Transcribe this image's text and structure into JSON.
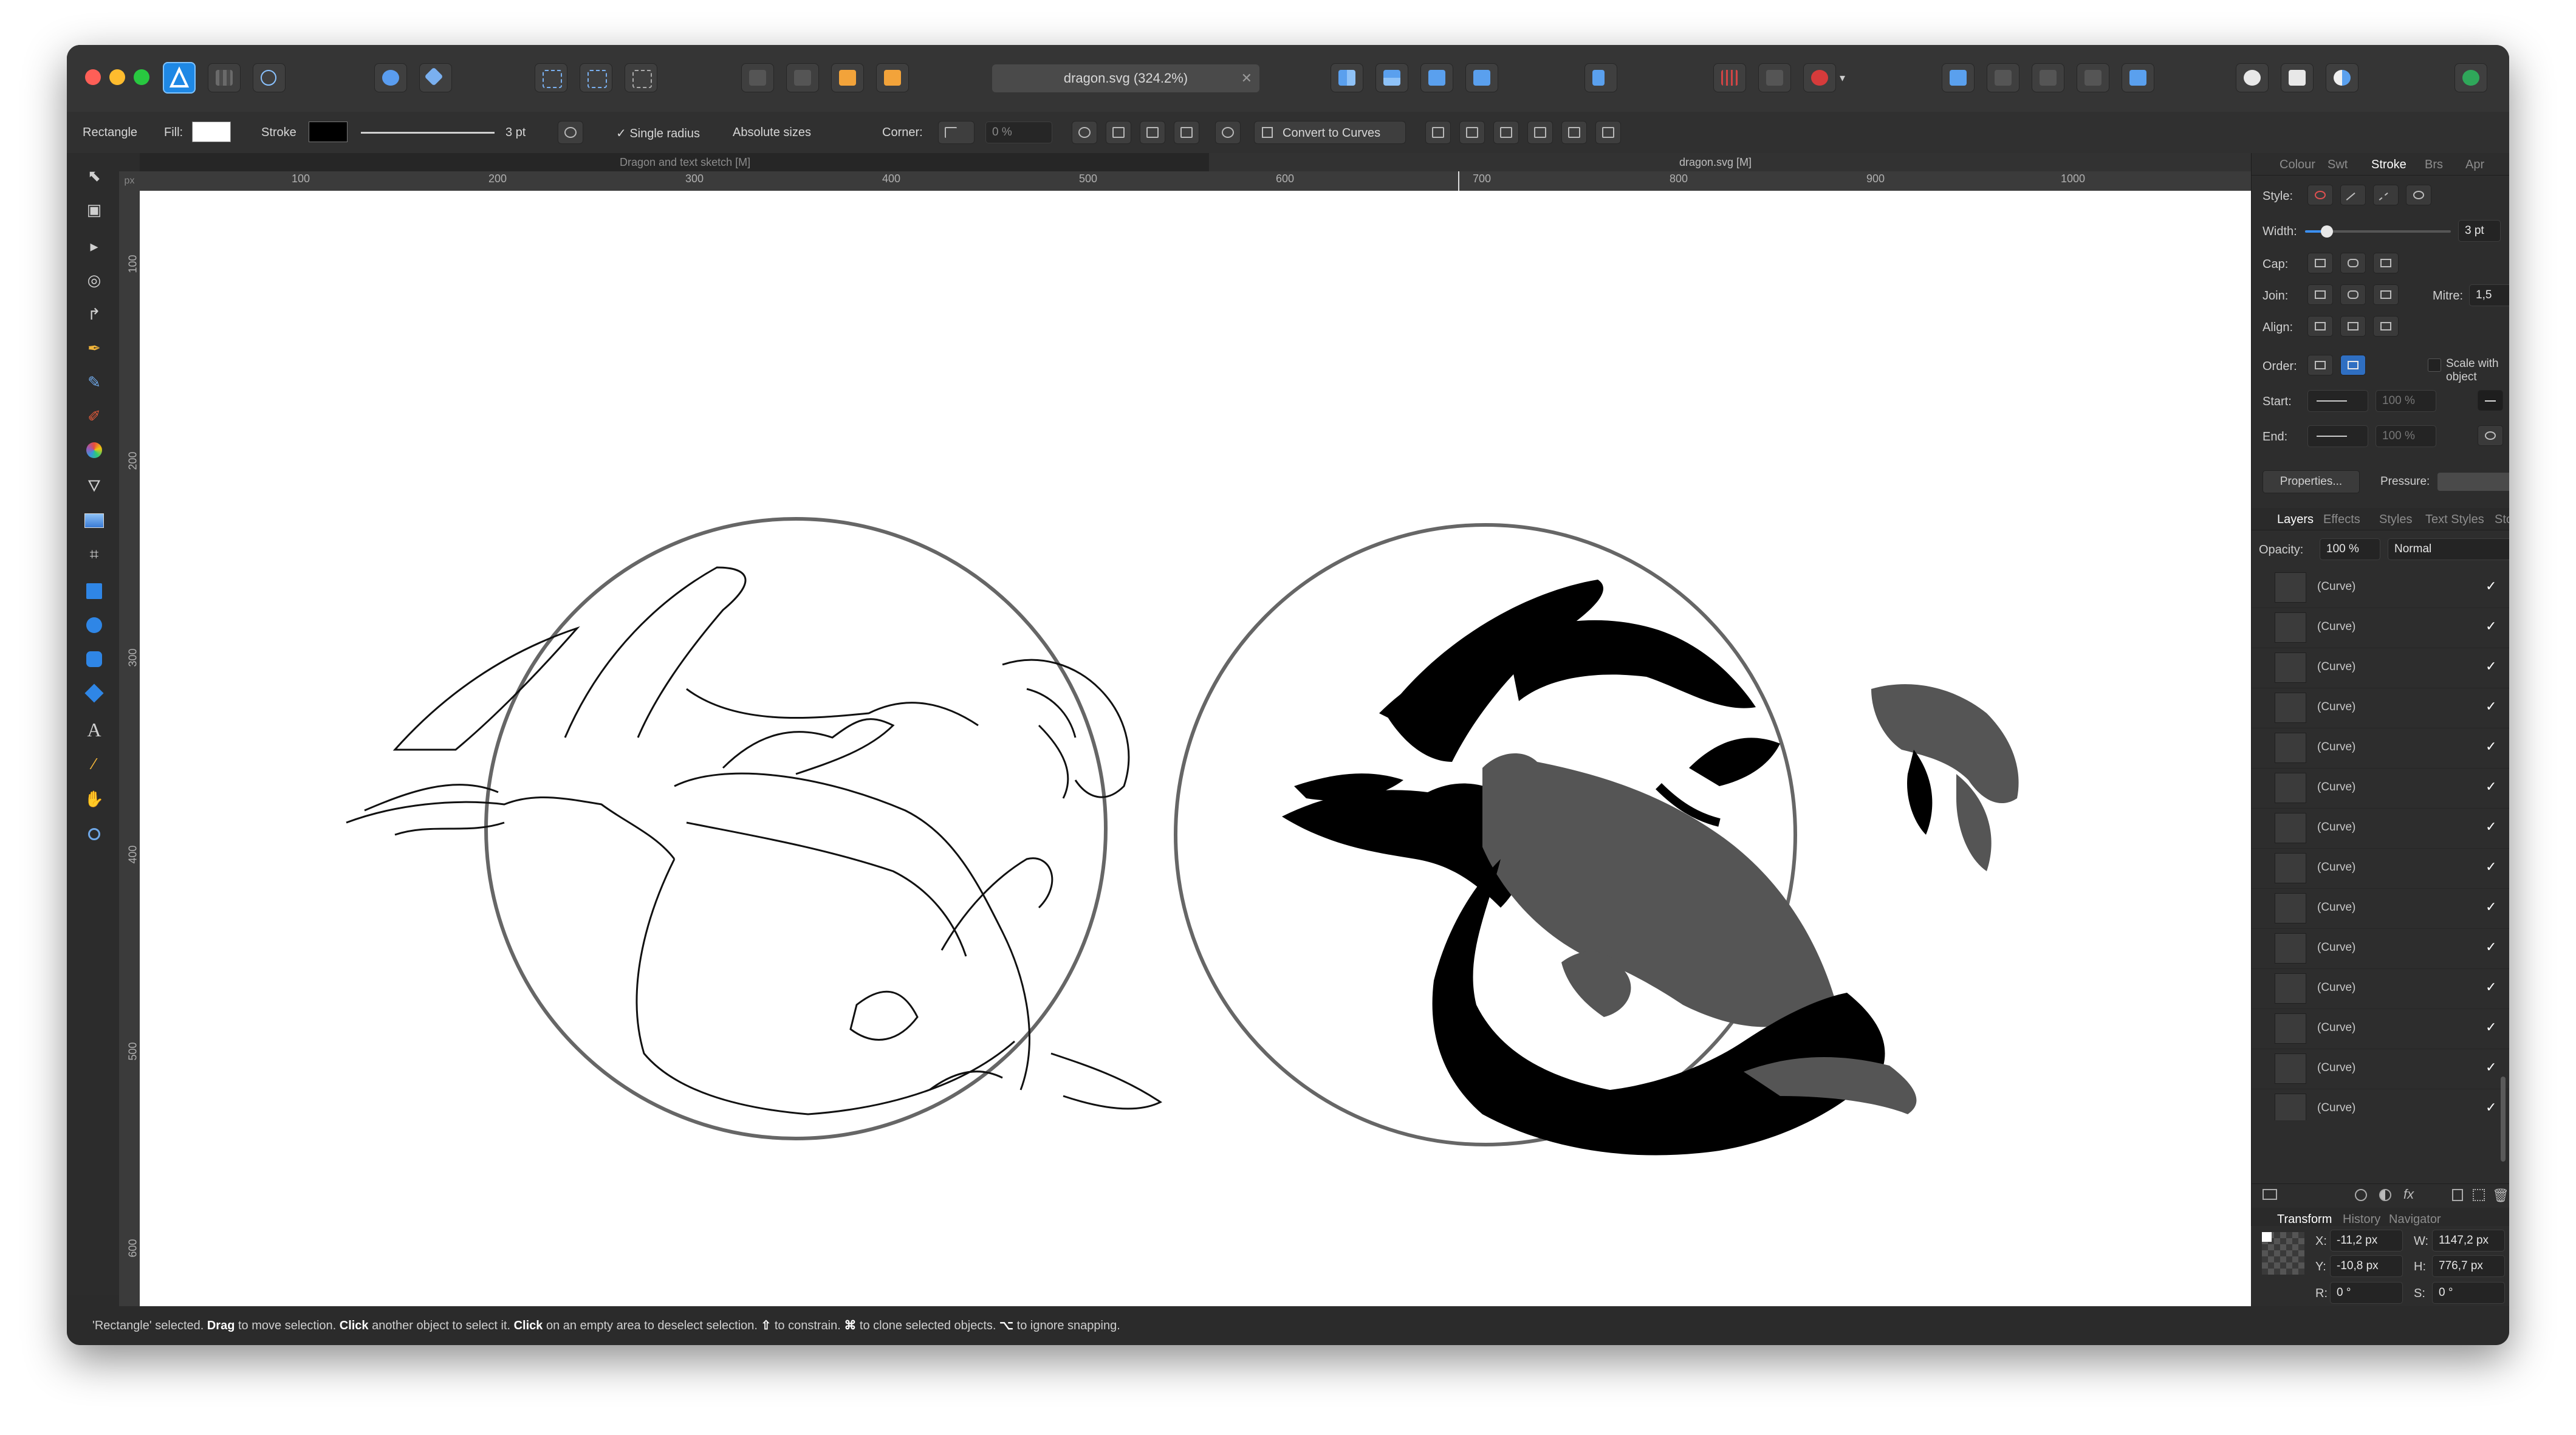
{
  "document": {
    "tab_title": "dragon.svg (324.2%)",
    "tab_close": "✕"
  },
  "context_toolbar": {
    "tool_name": "Rectangle",
    "fill_label": "Fill:",
    "stroke_label": "Stroke",
    "stroke_width": "3 pt",
    "single_radius": "✓ Single radius",
    "absolute_sizes": "Absolute sizes",
    "corner_label": "Corner:",
    "corner_value": "0 %",
    "convert_label": "Convert to Curves",
    "colors": {
      "fill": "#ffffff",
      "stroke": "#000000"
    }
  },
  "subtabs": [
    "Dragon and text sketch [M]",
    "dragon.svg [M]"
  ],
  "rulers": {
    "unit": "px",
    "h_ticks": [
      "100",
      "200",
      "300",
      "400",
      "500",
      "600",
      "700",
      "800",
      "900",
      "1000"
    ],
    "v_ticks": [
      "100",
      "200",
      "300",
      "400",
      "500",
      "600"
    ]
  },
  "tools": [
    "move-icon",
    "artboard-icon",
    "node-icon",
    "point-transform-icon",
    "corner-icon",
    "pen-icon",
    "pencil-icon",
    "vector-brush-icon",
    "fill-icon",
    "transparency-icon",
    "place-image-icon",
    "crop-icon",
    "rectangle-icon",
    "ellipse-icon",
    "rounded-rectangle-icon",
    "shape-icon",
    "artistic-text-icon",
    "color-picker-icon",
    "hand-icon",
    "zoom-icon"
  ],
  "stroke_panel": {
    "tabs": [
      "Colour",
      "Swt",
      "Stroke",
      "Brs",
      "Apr"
    ],
    "active": "Stroke",
    "style_label": "Style:",
    "width_label": "Width:",
    "width_value": "3 pt",
    "width_level": 0.15,
    "cap_label": "Cap:",
    "join_label": "Join:",
    "mitre_label": "Mitre:",
    "mitre_value": "1,5",
    "align_label": "Align:",
    "order_label": "Order:",
    "scale_label": "Scale with object",
    "start_label": "Start:",
    "end_label": "End:",
    "start_pct": "100 %",
    "end_pct": "100 %",
    "properties_btn": "Properties...",
    "pressure_label": "Pressure:"
  },
  "layers_panel": {
    "tabs": [
      "Layers",
      "Effects",
      "Styles",
      "Text Styles",
      "Stock"
    ],
    "active": "Layers",
    "opacity_label": "Opacity:",
    "opacity_value": "100 %",
    "blend_mode": "Normal",
    "items": [
      {
        "name": "(Curve)",
        "visible": "✓"
      },
      {
        "name": "(Curve)",
        "visible": "✓"
      },
      {
        "name": "(Curve)",
        "visible": "✓"
      },
      {
        "name": "(Curve)",
        "visible": "✓"
      },
      {
        "name": "(Curve)",
        "visible": "✓"
      },
      {
        "name": "(Curve)",
        "visible": "✓"
      },
      {
        "name": "(Curve)",
        "visible": "✓"
      },
      {
        "name": "(Curve)",
        "visible": "✓"
      },
      {
        "name": "(Curve)",
        "visible": "✓"
      },
      {
        "name": "(Curve)",
        "visible": "✓"
      },
      {
        "name": "(Curve)",
        "visible": "✓"
      },
      {
        "name": "(Curve)",
        "visible": "✓"
      },
      {
        "name": "(Curve)",
        "visible": "✓"
      },
      {
        "name": "(Curve)",
        "visible": "✓"
      }
    ]
  },
  "transform_panel": {
    "tabs": [
      "Transform",
      "History",
      "Navigator"
    ],
    "active": "Transform",
    "x_label": "X:",
    "x": "-11,2 px",
    "y_label": "Y:",
    "y": "-10,8 px",
    "w_label": "W:",
    "w": "1147,2 px",
    "h_label": "H:",
    "h": "776,7 px",
    "r_label": "R:",
    "r": "0 °",
    "s_label": "S:",
    "s": "0 °"
  },
  "status": {
    "p1": "'Rectangle' selected. ",
    "b1": "Drag",
    "p2": " to move selection. ",
    "b2": "Click",
    "p3": " another object to select it. ",
    "b3": "Click",
    "p4": " on an empty area to deselect selection. ",
    "b4": "⇧",
    "p5": " to constrain. ",
    "b5": "⌘",
    "p6": " to clone selected objects. ",
    "b6": "⌥",
    "p7": " to ignore snapping."
  }
}
